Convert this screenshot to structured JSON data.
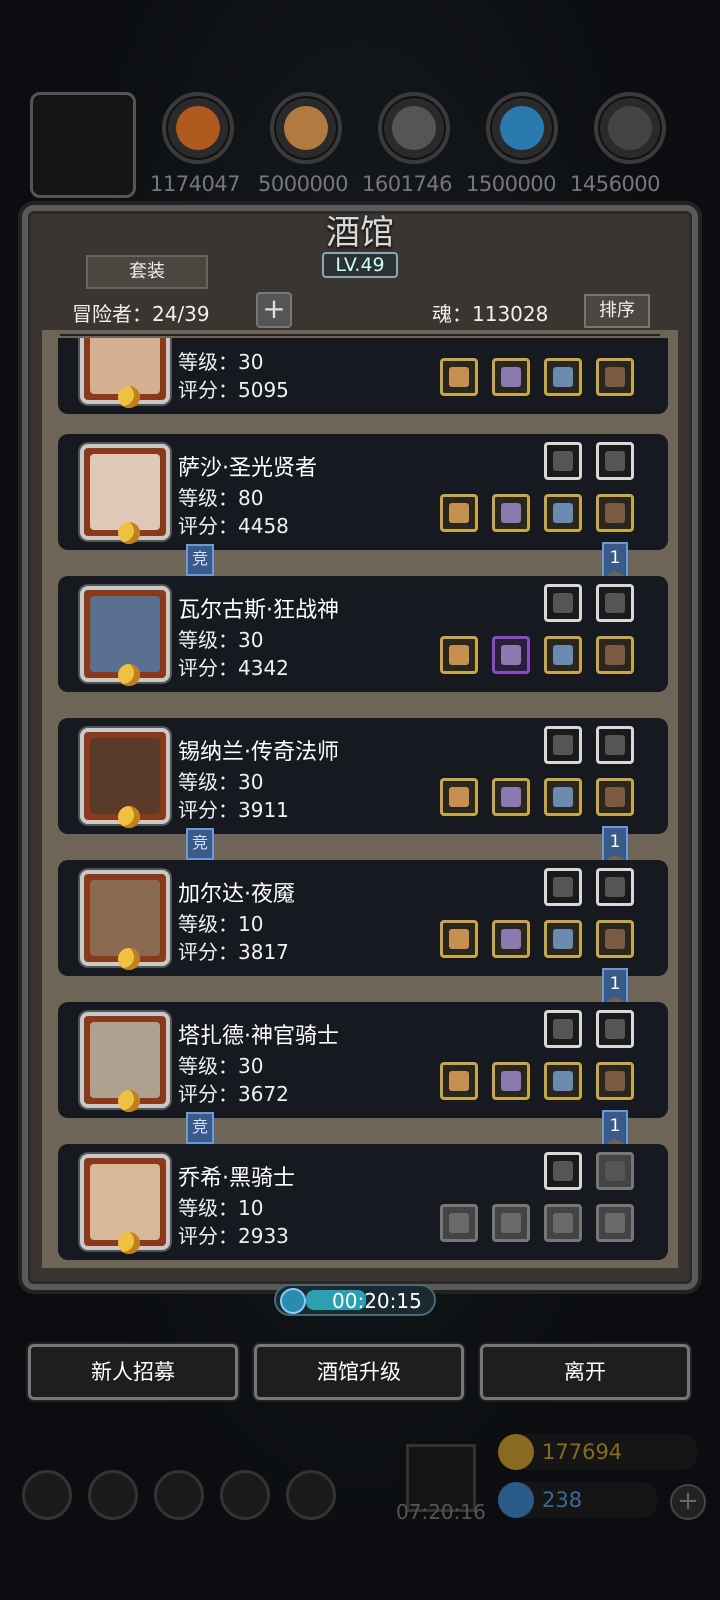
{
  "resources": [
    {
      "value": "1174047",
      "color": "#b05a20"
    },
    {
      "value": "5000000",
      "color": "#b07a40"
    },
    {
      "value": "1601746",
      "color": "#555555"
    },
    {
      "value": "1500000",
      "color": "#2a7ab0"
    },
    {
      "value": "1456000",
      "color": "#444444"
    }
  ],
  "panel": {
    "title": "酒馆",
    "level": "LV.49",
    "tab_label": "套装",
    "adventurers_label": "冒险者：24/39",
    "soul_label": "魂：113028",
    "sort_label": "排序",
    "plus_label": "+"
  },
  "heroes": [
    {
      "name": "",
      "level": "等级：30",
      "score": "评分：5095",
      "avatar_color": "#d6b090",
      "top_equip": [
        "white",
        "white"
      ],
      "equip": [
        "gold",
        "gold",
        "gold",
        "gold"
      ],
      "top_equip_hidden": true
    },
    {
      "name": "萨沙·圣光贤者",
      "level": "等级：80",
      "score": "评分：4458",
      "avatar_color": "#e0c8b8",
      "top_equip": [
        "white",
        "white"
      ],
      "equip": [
        "gold",
        "gold",
        "gold",
        "gold"
      ],
      "jing": "竞",
      "rank": "1"
    },
    {
      "name": "瓦尔古斯·狂战神",
      "level": "等级：30",
      "score": "评分：4342",
      "avatar_color": "#5a7090",
      "top_equip": [
        "white",
        "white"
      ],
      "equip": [
        "gold",
        "purple",
        "gold",
        "gold"
      ]
    },
    {
      "name": "锡纳兰·传奇法师",
      "level": "等级：30",
      "score": "评分：3911",
      "avatar_color": "#5a3a28",
      "top_equip": [
        "white",
        "white"
      ],
      "equip": [
        "gold",
        "gold",
        "gold",
        "gold"
      ],
      "jing": "竞",
      "rank": "1"
    },
    {
      "name": "加尔达·夜魇",
      "level": "等级：10",
      "score": "评分：3817",
      "avatar_color": "#8a6a50",
      "top_equip": [
        "white",
        "white"
      ],
      "equip": [
        "gold",
        "gold",
        "gold",
        "gold"
      ],
      "rank": "1"
    },
    {
      "name": "塔扎德·神官骑士",
      "level": "等级：30",
      "score": "评分：3672",
      "avatar_color": "#b0a090",
      "top_equip": [
        "white",
        "white"
      ],
      "equip": [
        "gold",
        "gold",
        "gold",
        "gold"
      ],
      "jing": "竞",
      "rank": "1"
    },
    {
      "name": "乔希·黑骑士",
      "level": "等级：10",
      "score": "评分：2933",
      "avatar_color": "#d8b898",
      "top_equip": [
        "white",
        "gray"
      ],
      "equip": [
        "gray",
        "gray",
        "gray",
        "gray"
      ]
    }
  ],
  "timer": "00:20:15",
  "buttons": {
    "recruit": "新人招募",
    "upgrade": "酒馆升级",
    "leave": "离开"
  },
  "gift_time": "07:20:16",
  "currency": {
    "gold": "177694",
    "gem": "238"
  }
}
